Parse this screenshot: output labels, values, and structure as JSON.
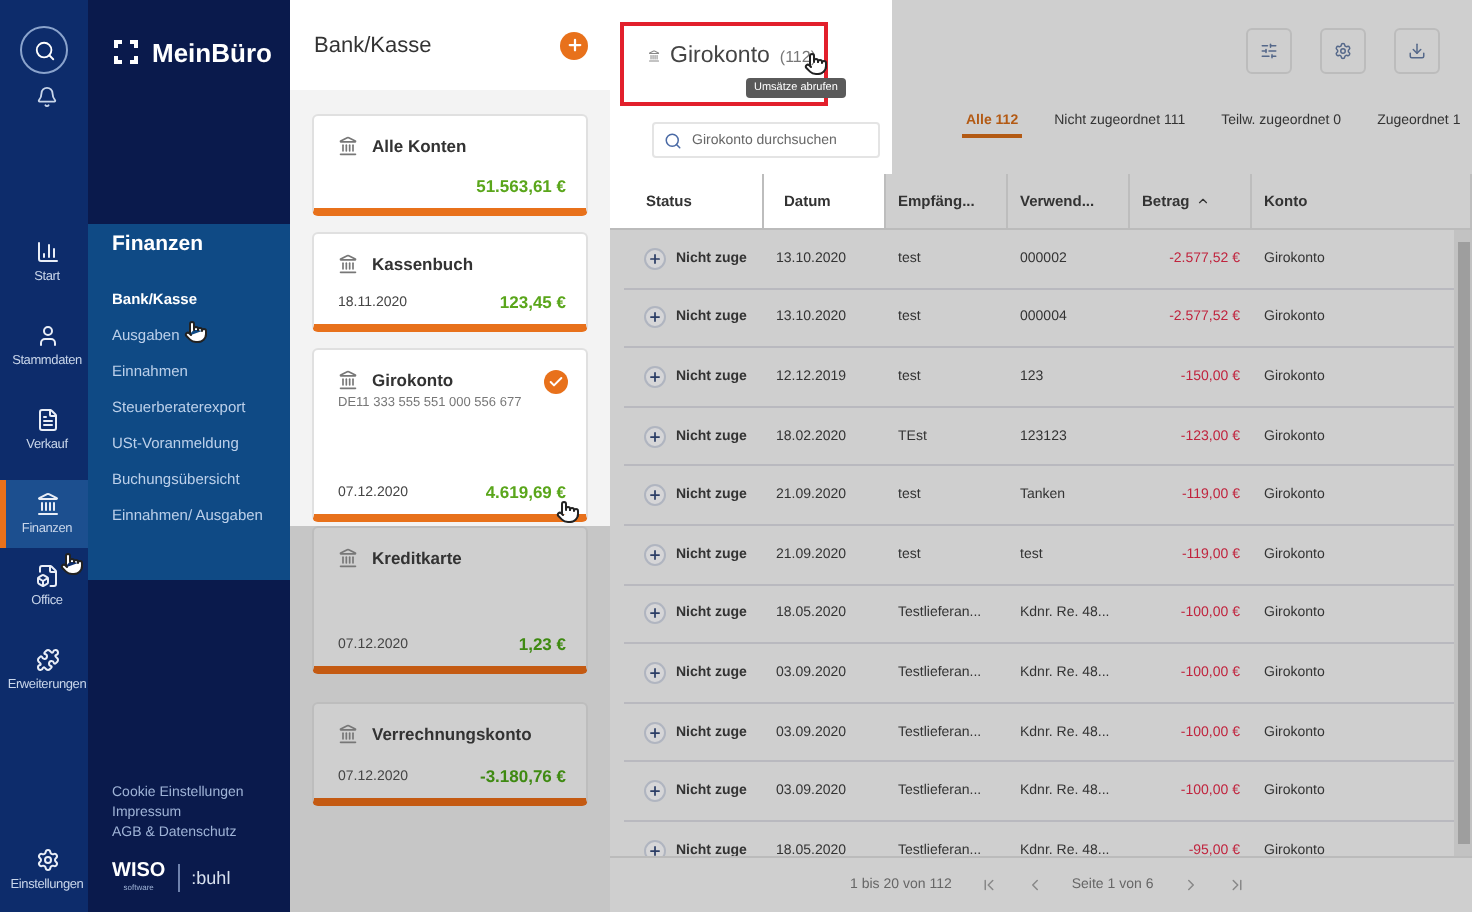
{
  "rail": {
    "items": [
      {
        "label": "Start",
        "selected": false
      },
      {
        "label": "Stammdaten",
        "selected": false
      },
      {
        "label": "Verkauf",
        "selected": false
      },
      {
        "label": "Finanzen",
        "selected": true
      },
      {
        "label": "Office",
        "selected": false
      },
      {
        "label": "Erweiterungen",
        "selected": false
      }
    ],
    "settings": "Einstellungen"
  },
  "nav": {
    "logo": "MeinBüro",
    "flyout_title": "Finanzen",
    "items": [
      {
        "label": "Bank/Kasse",
        "selected": true
      },
      {
        "label": "Ausgaben",
        "selected": false
      },
      {
        "label": "Einnahmen",
        "selected": false
      },
      {
        "label": "Steuerberaterexport",
        "selected": false
      },
      {
        "label": "USt-Voranmeldung",
        "selected": false
      },
      {
        "label": "Buchungsübersicht",
        "selected": false
      },
      {
        "label": "Einnahmen/ Ausgaben",
        "selected": false
      }
    ],
    "footer_links": [
      "Cookie Einstellungen",
      "Impressum",
      "AGB & Datenschutz"
    ],
    "brand": {
      "wiso": "WISO",
      "software": "software",
      "buhl": ":buhl"
    }
  },
  "accounts": {
    "title": "Bank/Kasse",
    "cards": [
      {
        "name": "Alle Konten",
        "amount": "51.563,61 €",
        "selected": false,
        "spotlight": true
      },
      {
        "name": "Kassenbuch",
        "date": "18.11.2020",
        "amount": "123,45 €",
        "selected": false,
        "spotlight": true
      },
      {
        "name": "Girokonto",
        "iban": "DE11 333 555 551 000 556 677",
        "date": "07.12.2020",
        "amount": "4.619,69 €",
        "selected": true,
        "spotlight": true
      },
      {
        "name": "Kreditkarte",
        "date": "07.12.2020",
        "amount": "1,23 €",
        "selected": false,
        "spotlight": false
      },
      {
        "name": "Verrechnungskonto",
        "date": "07.12.2020",
        "amount": "-3.180,76 €",
        "selected": false,
        "spotlight": false
      }
    ]
  },
  "main": {
    "title": "Girokonto",
    "count": "(112)",
    "tooltip": "Umsätze abrufen",
    "search": {
      "placeholder": "Girokonto durchsuchen"
    },
    "tabs": [
      {
        "label": "Alle",
        "count": "112",
        "selected": true
      },
      {
        "label": "Nicht zugeordnet",
        "count": "111",
        "selected": false
      },
      {
        "label": "Teilw. zugeordnet",
        "count": "0",
        "selected": false
      },
      {
        "label": "Zugeordnet",
        "count": "1",
        "selected": false
      }
    ],
    "table": {
      "columns": [
        "Status",
        "Datum",
        "Empfäng...",
        "Verwend...",
        "Betrag",
        "Konto"
      ],
      "rows": [
        [
          "Nicht zuge",
          "13.10.2020",
          "test",
          "000002",
          "-2.577,52 €",
          "Girokonto"
        ],
        [
          "Nicht zuge",
          "13.10.2020",
          "test",
          "000004",
          "-2.577,52 €",
          "Girokonto"
        ],
        [
          "Nicht zuge",
          "12.12.2019",
          "test",
          "123",
          "-150,00 €",
          "Girokonto"
        ],
        [
          "Nicht zuge",
          "18.02.2020",
          "TEst",
          "123123",
          "-123,00 €",
          "Girokonto"
        ],
        [
          "Nicht zuge",
          "21.09.2020",
          "test",
          "Tanken",
          "-119,00 €",
          "Girokonto"
        ],
        [
          "Nicht zuge",
          "21.09.2020",
          "test",
          "test",
          "-119,00 €",
          "Girokonto"
        ],
        [
          "Nicht zuge",
          "18.05.2020",
          "Testlieferan...",
          "Kdnr. Re. 48...",
          "-100,00 €",
          "Girokonto"
        ],
        [
          "Nicht zuge",
          "03.09.2020",
          "Testlieferan...",
          "Kdnr. Re. 48...",
          "-100,00 €",
          "Girokonto"
        ],
        [
          "Nicht zuge",
          "03.09.2020",
          "Testlieferan...",
          "Kdnr. Re. 48...",
          "-100,00 €",
          "Girokonto"
        ],
        [
          "Nicht zuge",
          "03.09.2020",
          "Testlieferan...",
          "Kdnr. Re. 48...",
          "-100,00 €",
          "Girokonto"
        ],
        [
          "Nicht zuge",
          "18.05.2020",
          "Testlieferan...",
          "Kdnr. Re. 48...",
          "-95,00 €",
          "Girokonto"
        ]
      ]
    },
    "pagination": {
      "range": "1 bis 20 von 112",
      "page": "Seite 1 von 6"
    }
  }
}
